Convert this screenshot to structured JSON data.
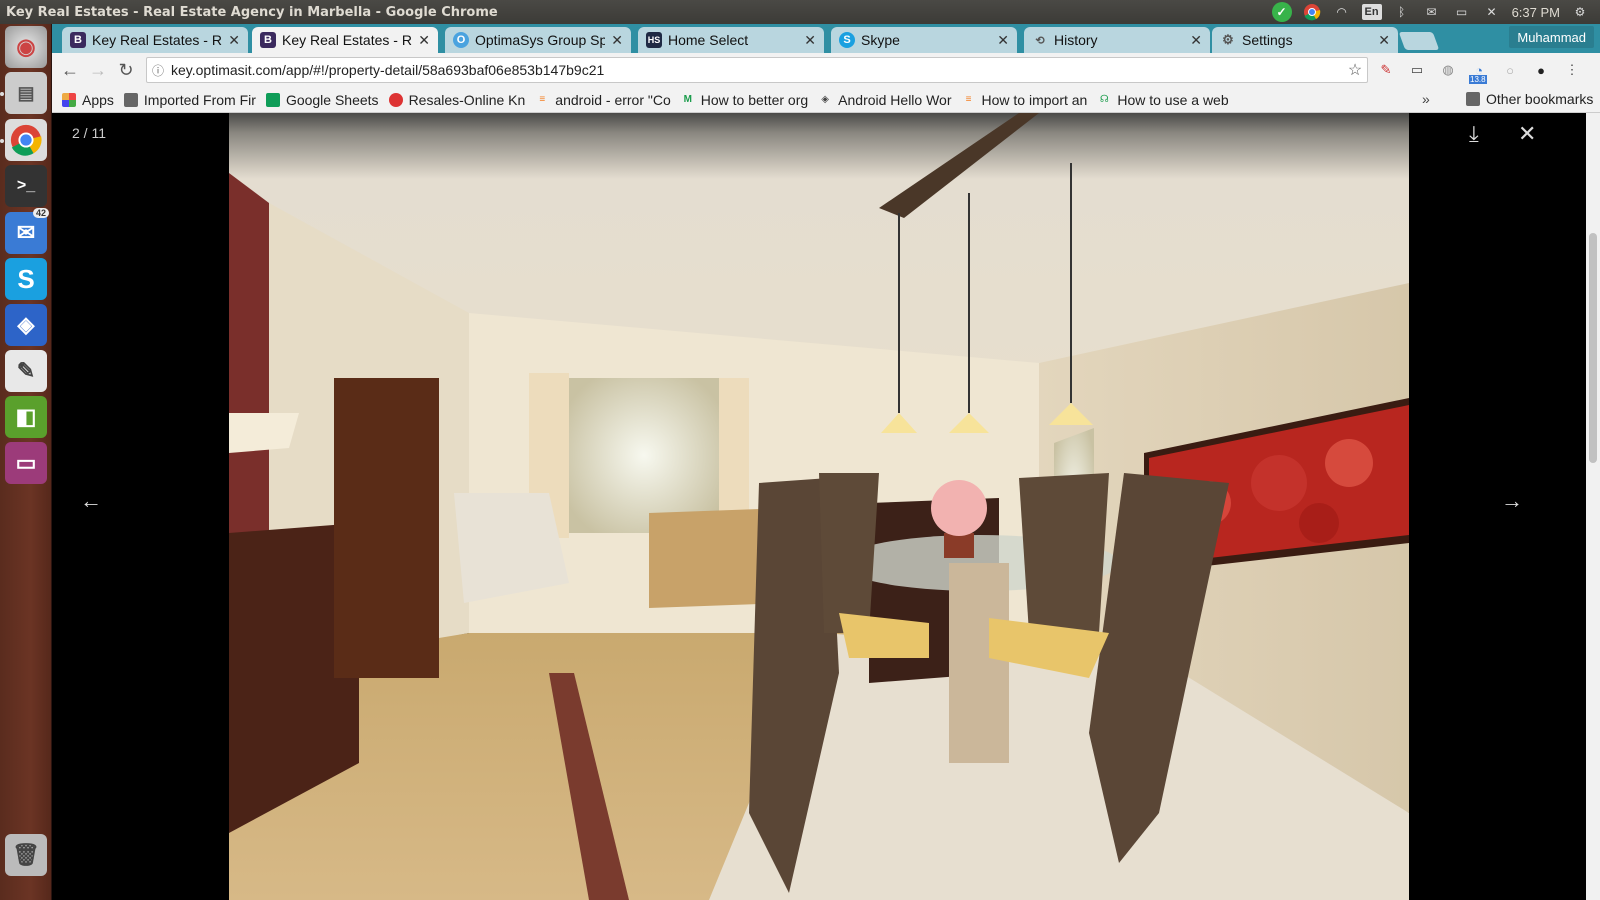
{
  "panel": {
    "window_title": "Key Real Estates - Real Estate Agency in Marbella - Google Chrome",
    "lang": "En",
    "time": "6:37 PM"
  },
  "launcher": {
    "thunderbird_badge": "42"
  },
  "tabs": [
    {
      "label": "Key Real Estates - Re",
      "favicon": "B"
    },
    {
      "label": "Key Real Estates - Re",
      "favicon": "B"
    },
    {
      "label": "OptimaSys Group Sp",
      "favicon": "O"
    },
    {
      "label": "Home Select",
      "favicon": "HS"
    },
    {
      "label": "Skype",
      "favicon": "S"
    },
    {
      "label": "History",
      "favicon": "⟲"
    },
    {
      "label": "Settings",
      "favicon": "⚙"
    }
  ],
  "profile_name": "Muhammad",
  "address": {
    "url": "key.optimasit.com/app/#!/property-detail/58a693baf06e853b147b9c21"
  },
  "extensions": {
    "badge": "13.8"
  },
  "bookmarks": [
    {
      "label": "Apps"
    },
    {
      "label": "Imported From Fir"
    },
    {
      "label": "Google Sheets"
    },
    {
      "label": "Resales-Online Kn"
    },
    {
      "label": "android - error \"Co"
    },
    {
      "label": "How to better org"
    },
    {
      "label": "Android Hello Wor"
    },
    {
      "label": "How to import an"
    },
    {
      "label": "How to use a web"
    }
  ],
  "bookmarks_more": "»",
  "other_bookmarks": "Other bookmarks",
  "viewer": {
    "counter": "2 / 11"
  },
  "colors": {
    "tabbar": "#2f8fa3",
    "launcher": "#6b3424",
    "panel": "#3c3b37"
  }
}
